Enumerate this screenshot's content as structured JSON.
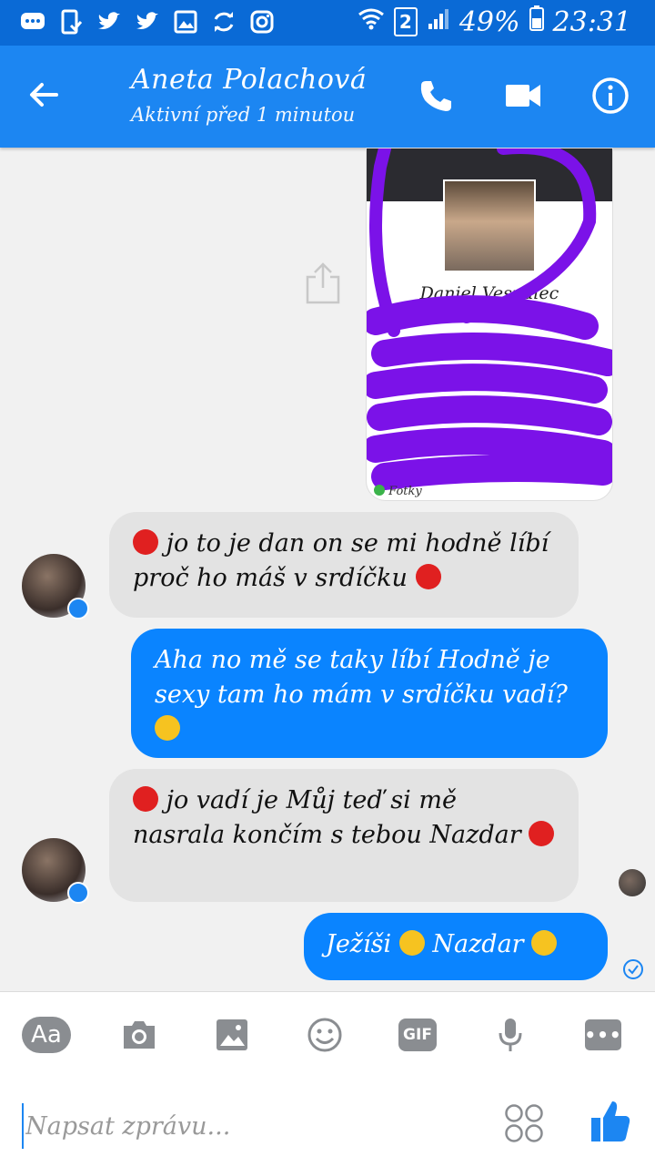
{
  "status_bar": {
    "sim_number": "2",
    "battery": "49%",
    "time": "23:31",
    "icons": [
      "messenger-notification-icon",
      "phone-check-icon",
      "twitter-icon",
      "twitter-icon",
      "image-icon",
      "sync-icon",
      "instagram-icon",
      "wifi-icon",
      "signal-icon",
      "battery-icon"
    ]
  },
  "header": {
    "contact_name": "Aneta Polachová",
    "status": "Aktivní před 1 minutou",
    "colors": {
      "bar": "#1c86f2",
      "status_bar": "#0a6ad6"
    }
  },
  "messages": {
    "shared_image": {
      "profile_name": "Daniel Vespalec",
      "footer": "Fotky"
    },
    "msg1": {
      "text": "jo to je dan on se mi hodně líbí proč ho máš v srdíčku",
      "sender": "incoming"
    },
    "msg2": {
      "text": "Aha no mě se taky líbí Hodně je sexy tam ho mám v srdíčku vadí?",
      "sender": "outgoing"
    },
    "msg3": {
      "text": "jo vadí je Můj teď si mě nasrala končím s tebou Nazdar",
      "sender": "incoming"
    },
    "msg4": {
      "part1": "Ježíši",
      "part2": "Nazdar",
      "sender": "outgoing"
    },
    "colors": {
      "incoming": "#e3e3e3",
      "outgoing": "#0a84ff"
    }
  },
  "composer": {
    "aa_label": "Aa",
    "gif_label": "GIF",
    "more_label": "•••",
    "placeholder": "Napsat zprávu..."
  }
}
